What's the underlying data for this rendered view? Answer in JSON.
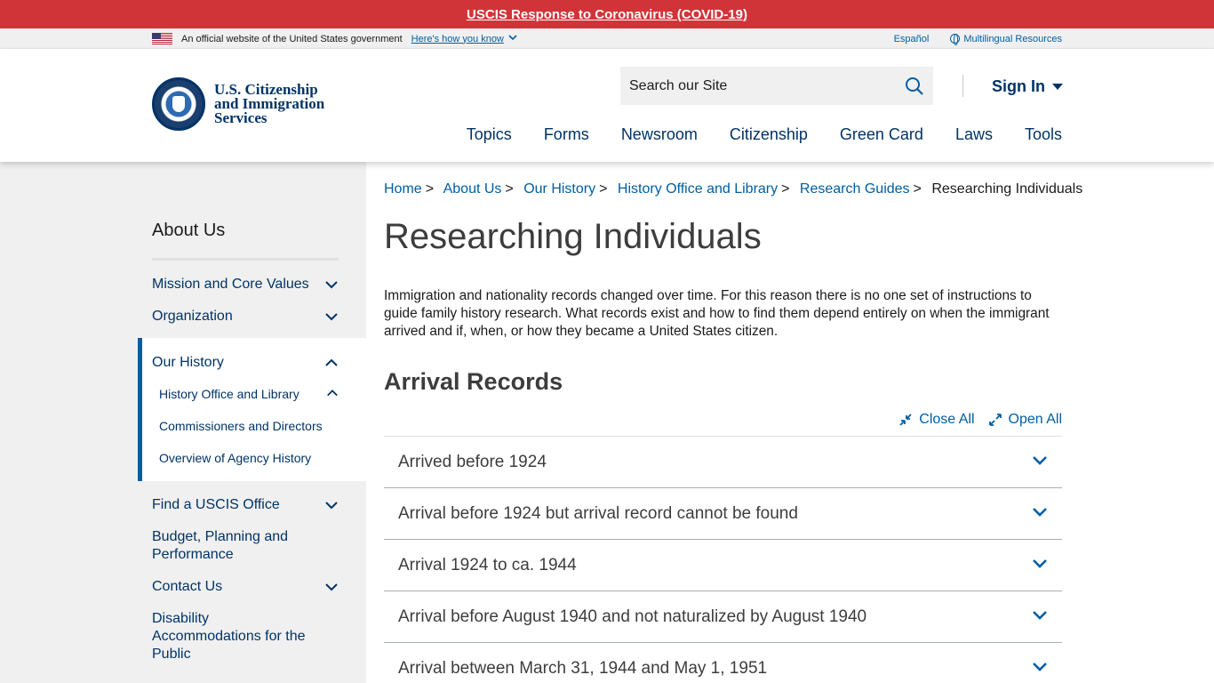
{
  "alert": {
    "text": "USCIS Response to Coronavirus (COVID-19)"
  },
  "gov_banner": {
    "official_text": "An official website of the United States government",
    "how_you_know": "Here's how you know",
    "espanol": "Español",
    "multilingual": "Multilingual Resources"
  },
  "header": {
    "logo_line1": "U.S. Citizenship",
    "logo_line2": "and Immigration",
    "logo_line3": "Services",
    "search_placeholder": "Search our Site",
    "sign_in": "Sign In",
    "nav": [
      "Topics",
      "Forms",
      "Newsroom",
      "Citizenship",
      "Green Card",
      "Laws",
      "Tools"
    ]
  },
  "sidebar": {
    "title": "About Us",
    "items": {
      "mission": "Mission and Core Values",
      "organization": "Organization",
      "our_history": "Our History",
      "history_office": "History Office and Library",
      "commissioners": "Commissioners and Directors",
      "overview": "Overview of Agency History",
      "find_office": "Find a USCIS Office",
      "budget_l1": "Budget, Planning and",
      "budget_l2": "Performance",
      "contact": "Contact Us",
      "disability_l1": "Disability",
      "disability_l2": "Accommodations for the",
      "disability_l3": "Public"
    }
  },
  "breadcrumb": {
    "items": [
      "Home",
      "About Us",
      "Our History",
      "History Office and Library",
      "Research Guides"
    ],
    "current": "Researching Individuals"
  },
  "main": {
    "title": "Researching Individuals",
    "intro": "Immigration and nationality records changed over time. For this reason there is no one set of instructions to guide family history research. What records exist and how to find them depend entirely on when the immigrant arrived and if, when, or how they became a United States citizen.",
    "section_title": "Arrival Records",
    "close_all": "Close All",
    "open_all": "Open All",
    "accordion": [
      "Arrived before 1924",
      "Arrival before 1924 but arrival record cannot be found",
      "Arrival 1924 to ca. 1944",
      "Arrival before August 1940 and not naturalized by August 1940",
      "Arrival between March 31, 1944 and May 1, 1951"
    ]
  },
  "colors": {
    "alert_red": "#d13438",
    "brand_navy": "#003366",
    "link_blue": "#005ea2"
  }
}
